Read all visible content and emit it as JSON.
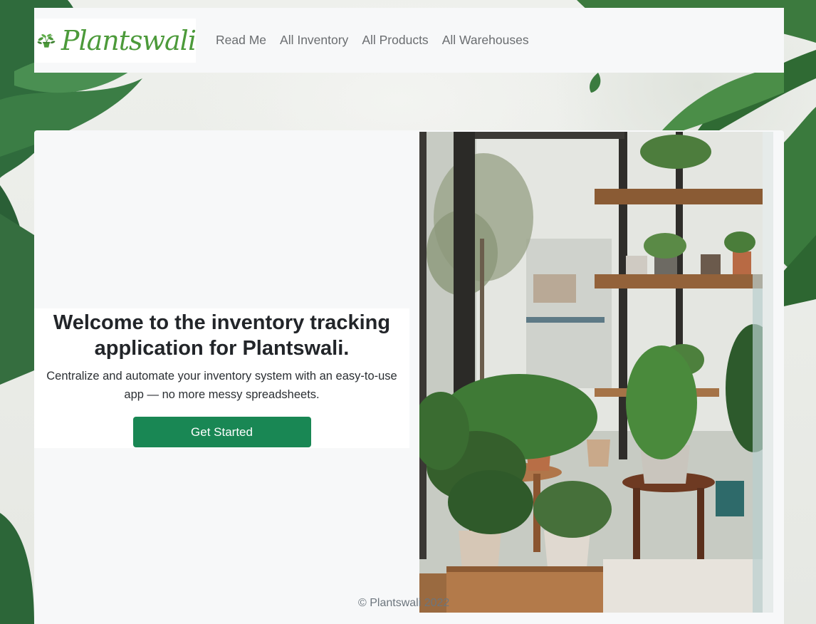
{
  "brand": {
    "name": "Plantswali",
    "logo_icon": "potted-plant-icon",
    "color": "#4c9a3a"
  },
  "nav": {
    "links": [
      "Read Me",
      "All Inventory",
      "All Products",
      "All Warehouses"
    ]
  },
  "hero": {
    "title": "Welcome to the inventory tracking application for Plantswali.",
    "subtitle": "Centralize and automate your inventory system with an easy-to-use app — no more messy spreadsheets.",
    "cta_label": "Get Started",
    "cta_color": "#198754"
  },
  "footer": {
    "copyright": "© Plantswali 2022"
  }
}
